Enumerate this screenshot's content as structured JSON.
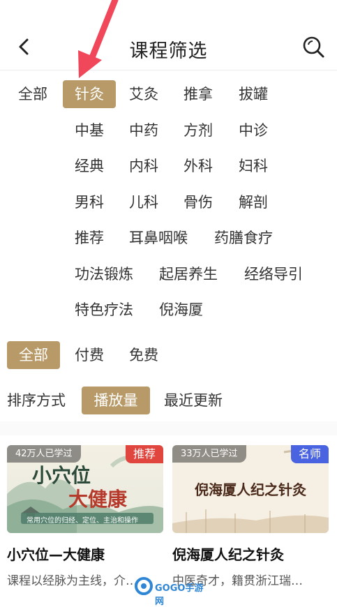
{
  "header": {
    "title": "课程筛选",
    "back_icon": "chevron-left-icon",
    "search_icon": "search-icon"
  },
  "categories": {
    "all_label": "全部",
    "items": [
      "针灸",
      "艾灸",
      "推拿",
      "拔罐",
      "中基",
      "中药",
      "方剂",
      "中诊",
      "经典",
      "内科",
      "外科",
      "妇科",
      "男科",
      "儿科",
      "骨伤",
      "解剖",
      "推荐",
      "耳鼻咽喉",
      "药膳食疗",
      "功法锻炼",
      "起居养生",
      "经络导引",
      "特色疗法",
      "倪海厦"
    ],
    "selected": "针灸"
  },
  "price_filter": {
    "options": [
      "全部",
      "付费",
      "免费"
    ],
    "selected": "全部"
  },
  "sort": {
    "label": "排序方式",
    "options": [
      "播放量",
      "最近更新"
    ],
    "selected": "播放量"
  },
  "courses": [
    {
      "learners": "42万人已学过",
      "tag": "推荐",
      "tag_color": "#e0453e",
      "cover_title_1": "小穴位",
      "cover_title_2": "大健康",
      "cover_subtitle": "常用穴位的归经、定位、主治和操作",
      "title": "小穴位—大健康",
      "desc": "课程以经脉为主线，介…"
    },
    {
      "learners": "33万人已学过",
      "tag": "名师",
      "tag_color": "#4a63e0",
      "cover_title_1": "倪海厦人纪之针灸",
      "title": "倪海厦人纪之针灸",
      "desc": "中医奇才，籍贯浙江瑞…"
    }
  ],
  "watermark": {
    "text": "GOGO手游网"
  },
  "colors": {
    "accent": "#b89a68",
    "arrow": "#f0475b"
  }
}
